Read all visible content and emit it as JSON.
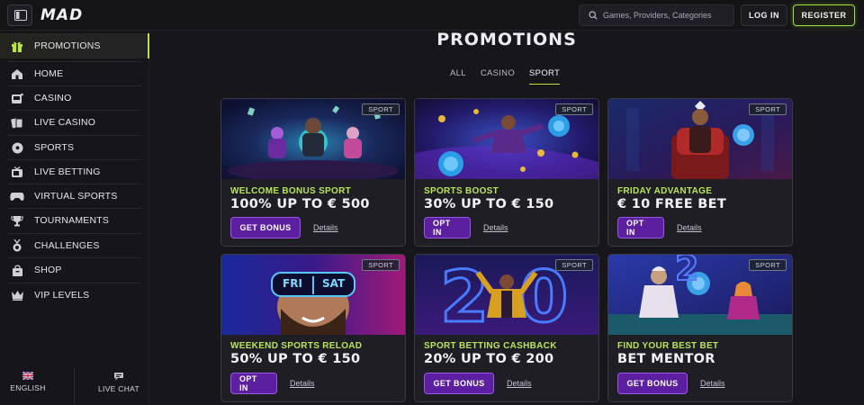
{
  "header": {
    "logo": "MAD",
    "search_placeholder": "Games, Providers, Categories",
    "login_label": "LOG IN",
    "register_label": "REGISTER"
  },
  "sidebar": {
    "items": [
      {
        "label": "PROMOTIONS",
        "icon": "gift-icon",
        "active": true
      },
      {
        "label": "HOME",
        "icon": "home-icon"
      },
      {
        "label": "CASINO",
        "icon": "casino-icon"
      },
      {
        "label": "LIVE CASINO",
        "icon": "cards-icon"
      },
      {
        "label": "SPORTS",
        "icon": "soccer-ball-icon"
      },
      {
        "label": "LIVE BETTING",
        "icon": "tv-icon"
      },
      {
        "label": "VIRTUAL SPORTS",
        "icon": "gamepad-icon"
      },
      {
        "label": "TOURNAMENTS",
        "icon": "trophy-icon"
      },
      {
        "label": "CHALLENGES",
        "icon": "medal-icon"
      },
      {
        "label": "SHOP",
        "icon": "shop-bag-icon"
      },
      {
        "label": "VIP LEVELS",
        "icon": "crown-icon"
      }
    ],
    "language_label": "ENGLISH",
    "live_chat_label": "LIVE CHAT"
  },
  "main": {
    "title": "PROMOTIONS",
    "tabs": [
      {
        "label": "ALL"
      },
      {
        "label": "CASINO"
      },
      {
        "label": "SPORT",
        "active": true
      }
    ],
    "cards": [
      {
        "badge": "SPORT",
        "subtitle": "WELCOME BONUS SPORT",
        "headline": "100% UP TO € 500",
        "cta": "GET BONUS",
        "details": "Details"
      },
      {
        "badge": "SPORT",
        "subtitle": "SPORTS BOOST",
        "headline": "30% UP TO € 150",
        "cta": "OPT IN",
        "details": "Details"
      },
      {
        "badge": "SPORT",
        "subtitle": "FRIDAY ADVANTAGE",
        "headline": "€ 10 FREE BET",
        "cta": "OPT IN",
        "details": "Details"
      },
      {
        "badge": "SPORT",
        "subtitle": "WEEKEND SPORTS RELOAD",
        "headline": "50% UP TO € 150",
        "cta": "OPT IN",
        "details": "Details",
        "art_text_1": "FRI",
        "art_text_2": "SAT"
      },
      {
        "badge": "SPORT",
        "subtitle": "SPORT BETTING CASHBACK",
        "headline": "20% UP TO € 200",
        "cta": "GET BONUS",
        "details": "Details"
      },
      {
        "badge": "SPORT",
        "subtitle": "FIND YOUR BEST BET",
        "headline": "BET MENTOR",
        "cta": "GET BONUS",
        "details": "Details"
      }
    ]
  },
  "colors": {
    "accent_green": "#b8e45a",
    "cta_purple": "#5b1fa0",
    "background": "#17171b"
  }
}
